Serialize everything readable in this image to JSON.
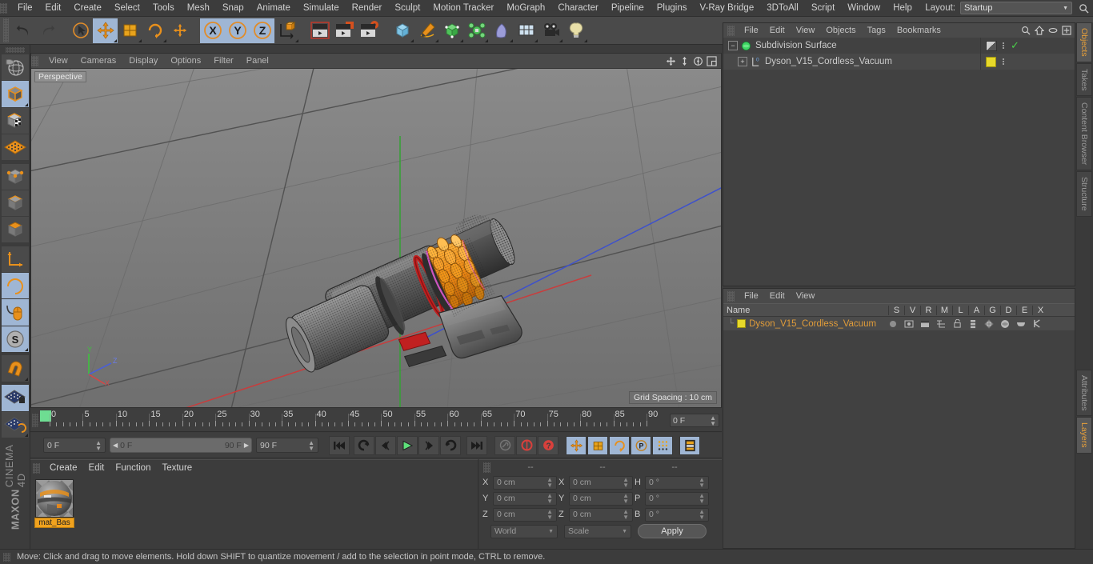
{
  "app": {
    "brand_maxon": "MAXON",
    "brand_c4d": "CINEMA 4D"
  },
  "top_menu": {
    "items": [
      "File",
      "Edit",
      "Create",
      "Select",
      "Tools",
      "Mesh",
      "Snap",
      "Animate",
      "Simulate",
      "Render",
      "Sculpt",
      "Motion Tracker",
      "MoGraph",
      "Character",
      "Pipeline",
      "Plugins",
      "V-Ray Bridge",
      "3DToAll",
      "Script",
      "Window",
      "Help"
    ],
    "layout_label": "Layout:",
    "layout_value": "Startup"
  },
  "toolbar": {
    "buttons": [
      {
        "name": "undo-button",
        "icon": "undo",
        "selected": false
      },
      {
        "name": "redo-button",
        "icon": "redo",
        "selected": false
      },
      {
        "name": "live-selection-button",
        "icon": "cursor-circle",
        "selected": false
      },
      {
        "name": "move-button",
        "icon": "move-arrows",
        "selected": true
      },
      {
        "name": "scale-button",
        "icon": "scale-box",
        "selected": false
      },
      {
        "name": "rotate-button",
        "icon": "rotate-ring",
        "selected": false
      },
      {
        "name": "move-alt-button",
        "icon": "move-arrows",
        "selected": false
      },
      {
        "name": "x-axis-button",
        "icon": "letter-x",
        "selected": true
      },
      {
        "name": "y-axis-button",
        "icon": "letter-y",
        "selected": true
      },
      {
        "name": "z-axis-button",
        "icon": "letter-z",
        "selected": true
      },
      {
        "name": "world-object-axis-button",
        "icon": "axis-cube",
        "selected": false
      },
      {
        "name": "render-view-button",
        "icon": "clapper",
        "selected": false
      },
      {
        "name": "render-region-button",
        "icon": "clapper-region",
        "selected": false
      },
      {
        "name": "render-settings-button",
        "icon": "clapper-gear",
        "selected": false
      },
      {
        "name": "primitive-cube-button",
        "icon": "cube-blue",
        "selected": false
      },
      {
        "name": "spline-pen-button",
        "icon": "pen",
        "selected": false
      },
      {
        "name": "generator-button",
        "icon": "cube-green",
        "selected": false
      },
      {
        "name": "deformer-button",
        "icon": "deformer",
        "selected": false
      },
      {
        "name": "scene-environment-button",
        "icon": "sphere-purple",
        "selected": false
      },
      {
        "name": "floor-button",
        "icon": "floor-grid",
        "selected": false
      },
      {
        "name": "camera-button",
        "icon": "camera",
        "selected": false
      },
      {
        "name": "light-button",
        "icon": "light-bulb",
        "selected": false
      }
    ]
  },
  "left_toolbar": {
    "buttons": [
      {
        "name": "make-editable-button",
        "icon": "globe-wire",
        "selected": false
      },
      {
        "name": "model-mode-button",
        "icon": "cube-orange-outline",
        "selected": true
      },
      {
        "name": "texture-mode-button",
        "icon": "cube-checker",
        "selected": false
      },
      {
        "name": "uv-mode-button",
        "icon": "grid-orange",
        "selected": false
      },
      {
        "name": "points-mode-button",
        "icon": "cube-points",
        "selected": false
      },
      {
        "name": "edges-mode-button",
        "icon": "cube-edges",
        "selected": false
      },
      {
        "name": "polygons-mode-button",
        "icon": "cube-poly",
        "selected": false
      },
      {
        "name": "object-axis-button",
        "icon": "axis-l",
        "selected": false
      },
      {
        "name": "enable-axis-button",
        "icon": "axis-rotate",
        "selected": false
      },
      {
        "name": "viewport-solo-button",
        "icon": "mouse",
        "selected": true
      },
      {
        "name": "snap-button",
        "icon": "letter-s-circle",
        "selected": true
      },
      {
        "name": "magnet-button",
        "icon": "magnet",
        "selected": false
      },
      {
        "name": "workplane-lock-button",
        "icon": "grid-lock",
        "selected": true
      },
      {
        "name": "workplane-rotate-button",
        "icon": "grid-rotate",
        "selected": false
      }
    ]
  },
  "viewport": {
    "menu": [
      "View",
      "Cameras",
      "Display",
      "Options",
      "Filter",
      "Panel"
    ],
    "label": "Perspective",
    "grid_spacing": "Grid Spacing : 10 cm",
    "nav_icons": [
      "pan-icon",
      "dolly-icon",
      "orbit-icon",
      "maximize-icon"
    ],
    "axis": {
      "x": "X",
      "y": "Y",
      "z": "Z",
      "x_color": "#d94c4c",
      "y_color": "#4cc44c",
      "z_color": "#4c5fd9"
    }
  },
  "timeline": {
    "ticks": [
      0,
      5,
      10,
      15,
      20,
      25,
      30,
      35,
      40,
      45,
      50,
      55,
      60,
      65,
      70,
      75,
      80,
      85,
      90
    ],
    "current_frame_field": "0 F"
  },
  "transport": {
    "current_frame": "0 F",
    "range_start": "0 F",
    "range_end": "90 F",
    "end_frame": "90 F",
    "buttons": [
      {
        "name": "go-to-start-button",
        "icon": "skip-start",
        "selected": false
      },
      {
        "name": "play-reverse-button",
        "icon": "rewind-loop",
        "selected": false
      },
      {
        "name": "previous-frame-button",
        "icon": "step-back",
        "selected": false
      },
      {
        "name": "play-button",
        "icon": "play",
        "selected": false
      },
      {
        "name": "next-frame-button",
        "icon": "step-forward",
        "selected": false
      },
      {
        "name": "play-forward-loop-button",
        "icon": "forward-loop",
        "selected": false
      },
      {
        "name": "go-to-end-button",
        "icon": "skip-end",
        "selected": false
      },
      {
        "name": "record-active-objects-button",
        "icon": "key",
        "selected": false
      },
      {
        "name": "autokeying-button",
        "icon": "record-circle",
        "selected": false
      },
      {
        "name": "keyframe-selection-button",
        "icon": "question-circle",
        "selected": false
      },
      {
        "name": "position-key-button",
        "icon": "move-arrows",
        "selected": true
      },
      {
        "name": "scale-key-button",
        "icon": "scale-box",
        "selected": true
      },
      {
        "name": "rotation-key-button",
        "icon": "rotate-ring",
        "selected": true
      },
      {
        "name": "parameter-key-button",
        "icon": "letter-p-circle",
        "selected": true
      },
      {
        "name": "point-level-animation-button",
        "icon": "dot-grid",
        "selected": true
      },
      {
        "name": "timeline-button",
        "icon": "film-strip",
        "selected": true
      }
    ]
  },
  "material_manager": {
    "menu": [
      "Create",
      "Edit",
      "Function",
      "Texture"
    ],
    "materials": [
      {
        "name": "mat_Bas"
      }
    ]
  },
  "coordinates": {
    "headers": [
      "--",
      "--",
      "--"
    ],
    "rows": [
      {
        "pos_label": "X",
        "pos_value": "0 cm",
        "size_label": "X",
        "size_value": "0 cm",
        "rot_label": "H",
        "rot_value": "0 °"
      },
      {
        "pos_label": "Y",
        "pos_value": "0 cm",
        "size_label": "Y",
        "size_value": "0 cm",
        "rot_label": "P",
        "rot_value": "0 °"
      },
      {
        "pos_label": "Z",
        "pos_value": "0 cm",
        "size_label": "Z",
        "size_value": "0 cm",
        "rot_label": "B",
        "rot_value": "0 °"
      }
    ],
    "coord_system": "World",
    "transform_mode": "Scale",
    "apply_label": "Apply"
  },
  "object_manager": {
    "menu": [
      "File",
      "Edit",
      "View",
      "Objects",
      "Tags",
      "Bookmarks"
    ],
    "icons": [
      "search-icon",
      "home-icon",
      "ellipse-icon",
      "add-panel-icon"
    ],
    "objects": [
      {
        "name": "Subdivision Surface",
        "indent": 0,
        "tag": "display",
        "check": true
      },
      {
        "name": "Dyson_V15_Cordless_Vacuum",
        "indent": 1,
        "tag": "material",
        "check": false
      }
    ]
  },
  "layer_manager": {
    "menu": [
      "File",
      "Edit",
      "View"
    ],
    "columns": [
      "Name",
      "S",
      "V",
      "R",
      "M",
      "L",
      "A",
      "G",
      "D",
      "E",
      "X"
    ],
    "rows": [
      {
        "name": "Dyson_V15_Cordless_Vacuum",
        "color": "#e8d92a"
      }
    ]
  },
  "vertical_tabs": {
    "top": [
      "Objects",
      "Takes",
      "Content Browser",
      "Structure"
    ],
    "bottom": [
      "Attributes",
      "Layers"
    ],
    "active_top": "Objects",
    "active_bottom": "Layers"
  },
  "status_bar": {
    "message": "Move: Click and drag to move elements. Hold down SHIFT to quantize movement / add to the selection in point mode, CTRL to remove."
  }
}
